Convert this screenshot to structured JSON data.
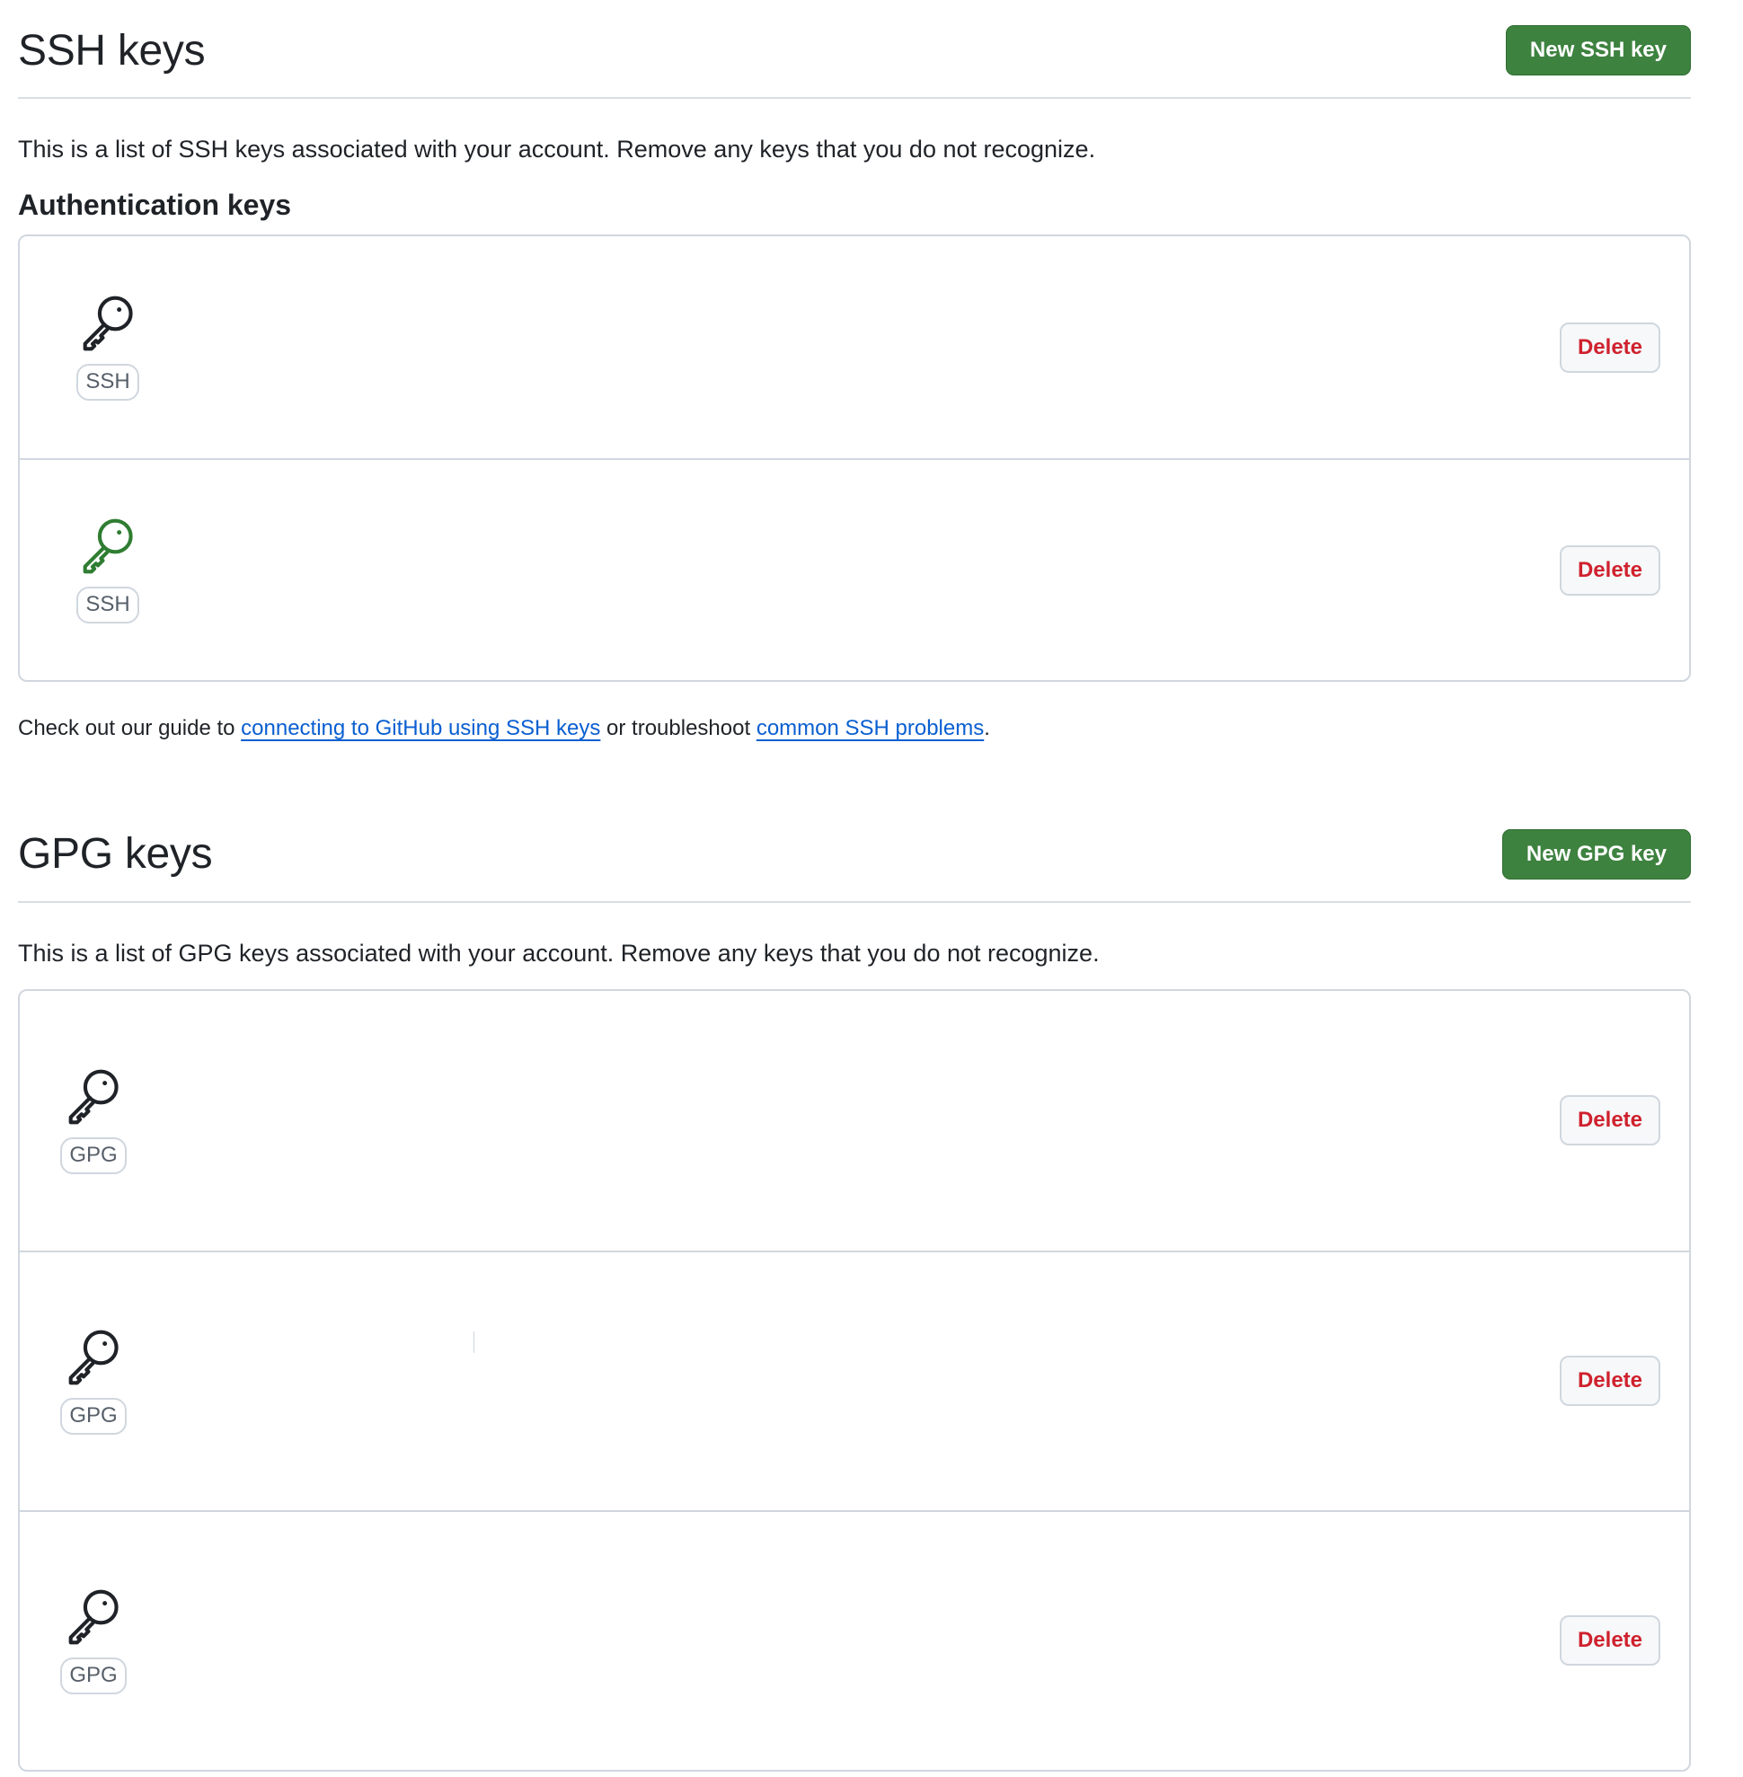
{
  "ssh": {
    "title": "SSH keys",
    "new_button": "New SSH key",
    "description": "This is a list of SSH keys associated with your account. Remove any keys that you do not recognize.",
    "auth_heading": "Authentication keys",
    "keys": [
      {
        "badge": "SSH",
        "icon": "key-icon",
        "icon_color": "#1f2328",
        "delete_label": "Delete"
      },
      {
        "badge": "SSH",
        "icon": "key-icon",
        "icon_color": "#2f7d32",
        "delete_label": "Delete"
      }
    ],
    "guide": {
      "prefix": "Check out our guide to ",
      "link1": "connecting to GitHub using SSH keys",
      "middle": " or troubleshoot ",
      "link2": "common SSH problems",
      "suffix": "."
    }
  },
  "gpg": {
    "title": "GPG keys",
    "new_button": "New GPG key",
    "description": "This is a list of GPG keys associated with your account. Remove any keys that you do not recognize.",
    "keys": [
      {
        "badge": "GPG",
        "icon": "key-icon",
        "icon_color": "#1f2328",
        "delete_label": "Delete"
      },
      {
        "badge": "GPG",
        "icon": "key-icon",
        "icon_color": "#1f2328",
        "delete_label": "Delete"
      },
      {
        "badge": "GPG",
        "icon": "key-icon",
        "icon_color": "#1f2328",
        "delete_label": "Delete"
      }
    ]
  },
  "colors": {
    "primary_button": "#3e8240",
    "danger_text": "#cf222e",
    "link": "#0a5fd1",
    "border": "#d0d7de"
  }
}
